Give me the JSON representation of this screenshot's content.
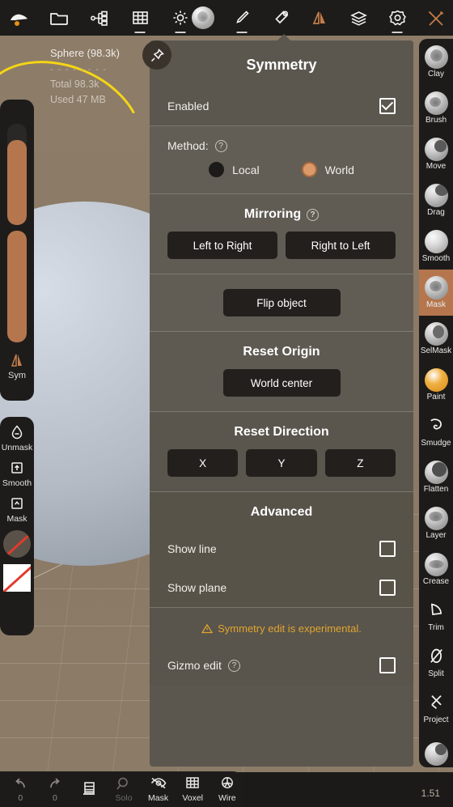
{
  "app": {
    "version": "1.51"
  },
  "toolbar": {
    "left_items": [
      {
        "name": "sculpt-logo-icon",
        "label": "Sculpt"
      },
      {
        "name": "folder-icon",
        "label": "Files"
      },
      {
        "name": "scene-graph-icon",
        "label": "Scene"
      },
      {
        "name": "grid-icon",
        "label": "Grid"
      },
      {
        "name": "light-icon",
        "label": "Light"
      }
    ],
    "right_items": [
      {
        "name": "material-sphere-icon",
        "label": "Material"
      },
      {
        "name": "brush-icon",
        "label": "Brush"
      },
      {
        "name": "paint-bucket-icon",
        "label": "Paint"
      },
      {
        "name": "symmetry-icon",
        "label": "Symmetry"
      },
      {
        "name": "layers-icon",
        "label": "Layers"
      },
      {
        "name": "settings-gear-icon",
        "label": "Settings"
      },
      {
        "name": "tools-icon",
        "label": "Tools"
      }
    ]
  },
  "stats": {
    "object_name": "Sphere (98.3k)",
    "divider": "- - - - - - - -",
    "total": "Total 98.3k",
    "used": "Used 47 MB"
  },
  "left_panel": {
    "sym_label": "Sym",
    "tools": [
      {
        "label": "Unmask",
        "icon": "droplet-minus-icon"
      },
      {
        "label": "Smooth",
        "icon": "box-up-arrow-icon"
      },
      {
        "label": "Mask",
        "icon": "box-caret-icon"
      }
    ]
  },
  "panel": {
    "title": "Symmetry",
    "pin_icon": "pin-icon",
    "enabled": {
      "label": "Enabled",
      "checked": true
    },
    "method": {
      "label": "Method:",
      "help": "?",
      "options": [
        {
          "label": "Local",
          "selected": false
        },
        {
          "label": "World",
          "selected": true
        }
      ]
    },
    "mirroring": {
      "title": "Mirroring",
      "help": "?",
      "buttons": [
        "Left to Right",
        "Right to Left"
      ],
      "flip": "Flip object"
    },
    "reset_origin": {
      "title": "Reset Origin",
      "button": "World center"
    },
    "reset_direction": {
      "title": "Reset Direction",
      "buttons": [
        "X",
        "Y",
        "Z"
      ]
    },
    "advanced": {
      "title": "Advanced",
      "show_line": {
        "label": "Show line",
        "checked": false
      },
      "show_plane": {
        "label": "Show plane",
        "checked": false
      },
      "warning": "Symmetry edit is experimental.",
      "warning_icon": "warning-triangle-icon",
      "gizmo": {
        "label": "Gizmo edit",
        "help": "?",
        "checked": false
      }
    }
  },
  "brushes": [
    {
      "label": "Clay",
      "active": false
    },
    {
      "label": "Brush",
      "active": false
    },
    {
      "label": "Move",
      "active": false
    },
    {
      "label": "Drag",
      "active": false
    },
    {
      "label": "Smooth",
      "active": false
    },
    {
      "label": "Mask",
      "active": true
    },
    {
      "label": "SelMask",
      "active": false
    },
    {
      "label": "Paint",
      "active": false
    },
    {
      "label": "Smudge",
      "active": false
    },
    {
      "label": "Flatten",
      "active": false
    },
    {
      "label": "Layer",
      "active": false
    },
    {
      "label": "Crease",
      "active": false
    },
    {
      "label": "Trim",
      "active": false
    },
    {
      "label": "Split",
      "active": false
    },
    {
      "label": "Project",
      "active": false
    }
  ],
  "bottombar": {
    "undo": {
      "icon": "undo-icon",
      "count": "0"
    },
    "redo": {
      "icon": "redo-icon",
      "count": "0"
    },
    "layers": {
      "icon": "layers-list-icon",
      "label": ""
    },
    "solo": {
      "icon": "solo-icon",
      "label": "Solo",
      "dim": true
    },
    "mask": {
      "icon": "mask-eye-icon",
      "label": "Mask"
    },
    "voxel": {
      "icon": "voxel-grid-icon",
      "label": "Voxel"
    },
    "wire": {
      "icon": "wire-globe-icon",
      "label": "Wire"
    }
  },
  "colors": {
    "accent_orange": "#b5764e",
    "warning": "#e0a52e",
    "panel_bg": "#5b574f",
    "viewport_bg": "#8a7a66"
  }
}
